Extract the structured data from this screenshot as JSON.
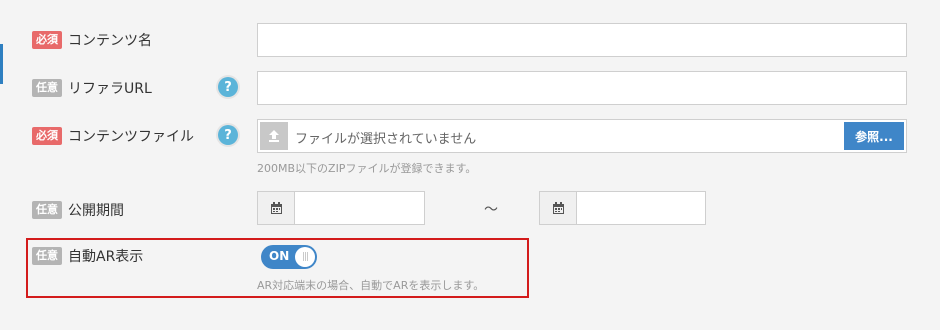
{
  "badges": {
    "required": "必須",
    "optional": "任意"
  },
  "fields": {
    "content_name": {
      "label": "コンテンツ名",
      "value": "",
      "placeholder": ""
    },
    "referrer_url": {
      "label": "リファラURL",
      "value": "",
      "placeholder": ""
    },
    "content_file": {
      "label": "コンテンツファイル",
      "placeholder": "ファイルが選択されていません",
      "browse_label": "参照...",
      "hint": "200MB以下のZIPファイルが登録できます。"
    },
    "publish_period": {
      "label": "公開期間",
      "separator": "〜",
      "start_value": "",
      "end_value": ""
    },
    "auto_ar": {
      "label": "自動AR表示",
      "toggle_state": "ON",
      "toggle_on": true,
      "hint": "AR対応端末の場合、自動でARを表示します。"
    }
  },
  "help_icon_glyph": "?",
  "colors": {
    "required_badge": "#e86a6a",
    "optional_badge": "#b4b4b4",
    "primary": "#3f86c8",
    "help_icon": "#5bb4d9",
    "highlight": "#d31b1b"
  },
  "icons": [
    "upload-icon",
    "calendar-icon",
    "help-icon"
  ]
}
